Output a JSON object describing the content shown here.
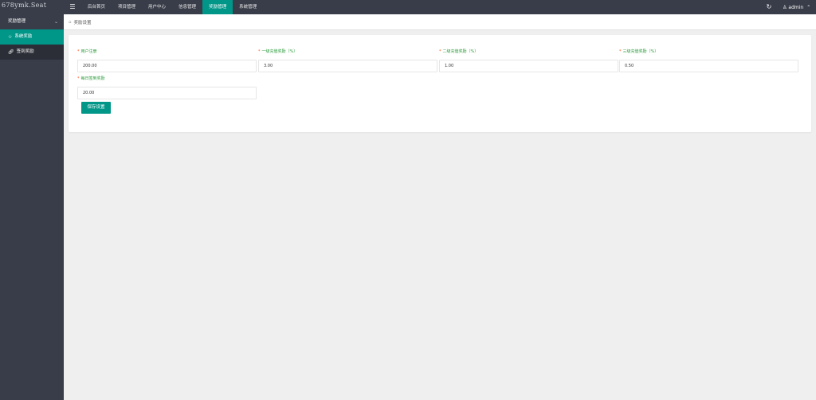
{
  "app": {
    "logo_text": "678ymk.Seat"
  },
  "header": {
    "menu_toggle_icon": "hamburger-icon",
    "nav": [
      {
        "label": "后台首页"
      },
      {
        "label": "项目管理"
      },
      {
        "label": "用户中心"
      },
      {
        "label": "信息管理"
      },
      {
        "label": "奖励管理",
        "active": true
      },
      {
        "label": "系统管理"
      }
    ],
    "refresh_icon": "refresh-icon",
    "user": {
      "name": "admin"
    }
  },
  "sidebar": {
    "group_label": "奖励管理",
    "items": [
      {
        "label": "系统奖励",
        "icon": "star-icon",
        "active": true
      },
      {
        "label": "签到奖励",
        "icon": "link-icon"
      }
    ]
  },
  "breadcrumb": {
    "label": "奖励设置"
  },
  "form": {
    "fields": [
      {
        "label": "用户注册",
        "value": "200.00"
      },
      {
        "label": "一级充值奖励（%）",
        "value": "3.00"
      },
      {
        "label": "二级充值奖励（%）",
        "value": "1.00"
      },
      {
        "label": "三级充值奖励（%）",
        "value": "0.50"
      },
      {
        "label": "每日签到奖励",
        "value": "20.00"
      }
    ],
    "save_label": "保存设置"
  },
  "colors": {
    "accent": "#009688",
    "header_bg": "#393d49",
    "label_green": "#2a9a3a",
    "required": "#ff5722"
  }
}
